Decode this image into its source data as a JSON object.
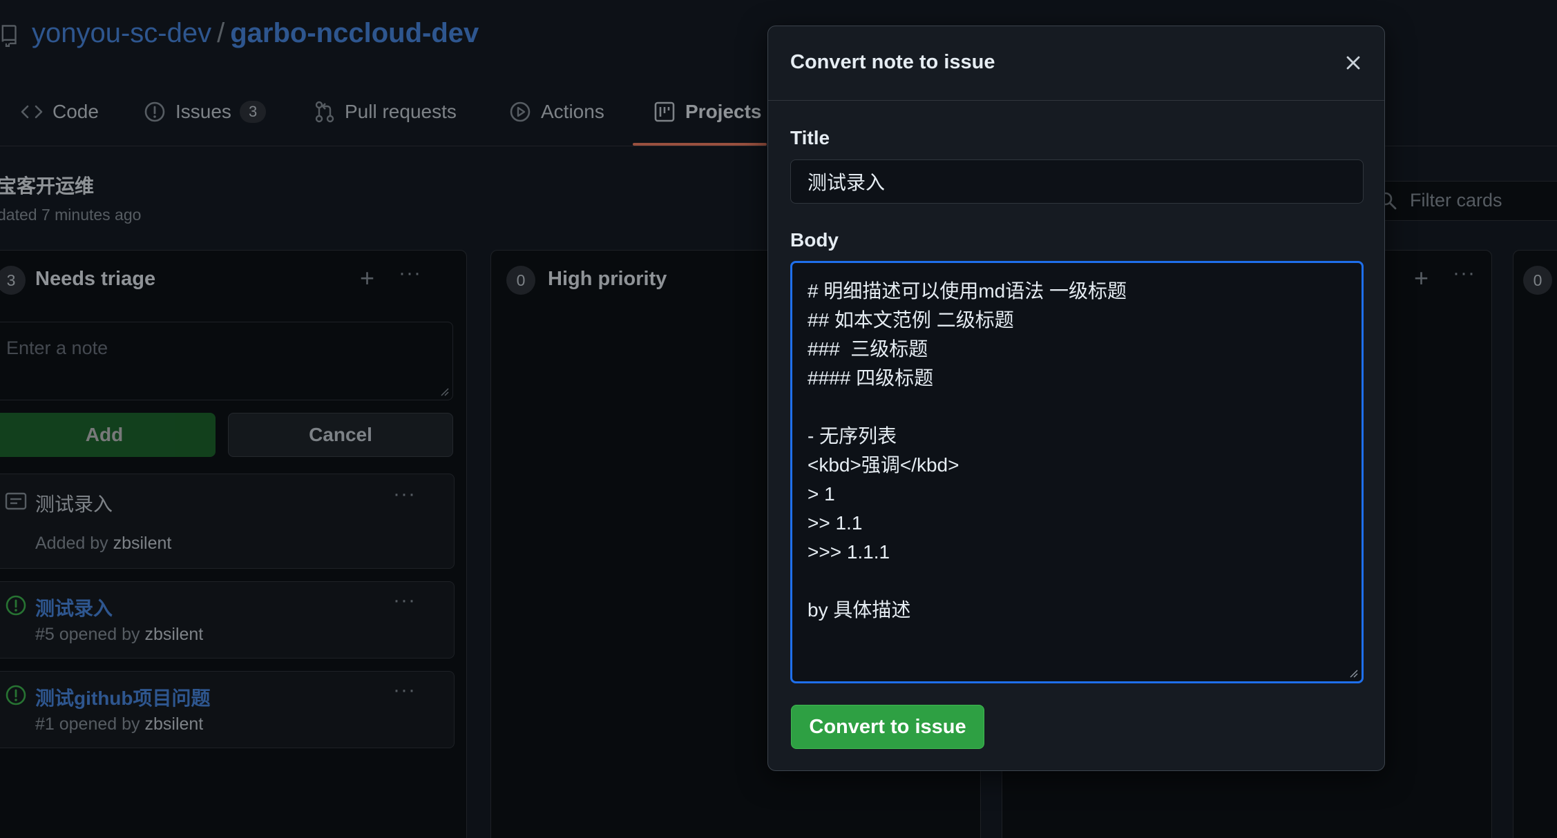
{
  "repo": {
    "owner": "yonyou-sc-dev",
    "separator": "/",
    "name": "garbo-nccloud-dev"
  },
  "tabs": [
    {
      "label": "Code",
      "icon": "code-icon"
    },
    {
      "label": "Issues",
      "icon": "issue-opened-icon",
      "count": "3"
    },
    {
      "label": "Pull requests",
      "icon": "git-pull-request-icon"
    },
    {
      "label": "Actions",
      "icon": "play-icon"
    },
    {
      "label": "Projects",
      "icon": "project-icon",
      "active": true
    }
  ],
  "project": {
    "title": "宝客开运维",
    "updated": "dated 7 minutes ago"
  },
  "filter": {
    "placeholder": "Filter cards"
  },
  "columns": [
    {
      "count": "3",
      "name": "Needs triage"
    },
    {
      "count": "0",
      "name": "High priority"
    },
    {
      "count": "0",
      "name": ""
    }
  ],
  "note_form": {
    "placeholder": "Enter a note",
    "add_label": "Add",
    "cancel_label": "Cancel"
  },
  "cards": [
    {
      "type": "note",
      "icon": "note-icon",
      "title": "测试录入",
      "meta_prefix": "Added by ",
      "user": "zbsilent"
    },
    {
      "type": "issue",
      "icon": "issue-opened-icon",
      "title": "测试录入",
      "meta_prefix": "#5 opened by ",
      "user": "zbsilent"
    },
    {
      "type": "issue",
      "icon": "issue-opened-icon",
      "title": "测试github项目问题",
      "meta_prefix": "#1 opened by ",
      "user": "zbsilent"
    }
  ],
  "modal": {
    "title": "Convert note to issue",
    "title_label": "Title",
    "title_value": "测试录入",
    "body_label": "Body",
    "body_lines": [
      "# 明细描述可以使用md语法 一级标题",
      "## 如本文范例 二级标题",
      "###  三级标题",
      "#### 四级标题",
      "",
      "- 无序列表",
      "<kbd>强调</kbd>",
      "> 1",
      ">> 1.1",
      ">>> 1.1.1",
      "",
      "by 具体描述"
    ],
    "submit_label": "Convert to issue"
  },
  "colors": {
    "accent": "#1f6feb",
    "link": "#4b8be6",
    "success": "#2ea043",
    "underline": "#f78166",
    "background": "#0d1117",
    "panel": "#161b22"
  }
}
